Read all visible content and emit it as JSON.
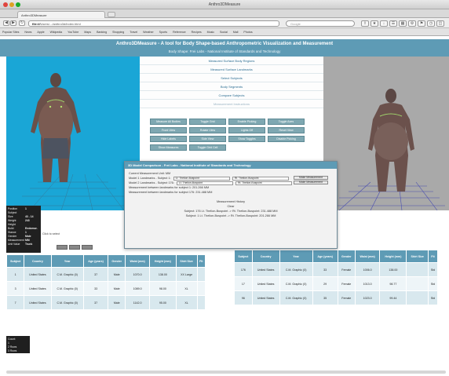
{
  "browser": {
    "window_title": "Anthro3DMeasure",
    "tab_title": "Anthro3DMeasure",
    "url_prefix": "file:///",
    "url_path": "Users/.../anthro3d/index.html",
    "search_placeholder": "Google",
    "bookmarks": [
      "Popular Sites",
      "News",
      "Apple",
      "Wikipedia",
      "YouTube",
      "Maps",
      "Banking",
      "Shopping",
      "Travel",
      "Weather",
      "Sports",
      "Reference",
      "Recipes",
      "Music",
      "Social",
      "Mail",
      "Photos"
    ]
  },
  "page": {
    "title": "Anthro3DMeasure - A tool for Body Shape-based Anthropometric Visualization and Measurement",
    "subtitle": "Body Shape: Frei Labs - National Institute of Standards and Technology",
    "menu": [
      "Measured Surface Body Regions",
      "Measured Surface Landmarks",
      "Select Subjects",
      "Body Segments",
      "Compare Subjects",
      "Measurement Instructions"
    ],
    "buttons": [
      "Measure All Bodies",
      "Toggle Grid",
      "Enable Picking",
      "Toggle Axes",
      "Front View",
      "Rotate View",
      "Lights Off",
      "Reset View",
      "Hide Labels",
      "Side View",
      "Show Toggles",
      "Disable Picking",
      "Show Measures",
      "Toggle Grid Cell"
    ]
  },
  "dialog": {
    "title": "3D Model Comparison - Frei Labs - National Institute of Standards and Technology",
    "line1": "Current Measurement Unit: MM",
    "line2_label": "Model 1 Landmarks - Subject 1:",
    "line2_select_a": "Lt. Thelion-Buspoint",
    "line2_select_b": "Rt. Thelion-Buspoint",
    "line3_label": "Model 2 Landmarks - Subject 176:",
    "line3_select_a": "Lt. Thelion-Buspoint",
    "line3_select_b": "Rt. Thelion-Buspoint",
    "make_measurement": "Make Measurement",
    "line4": "Measurement between landmarks for subject 1: 201.266 MM",
    "line5": "Measurement between landmarks for subject 176: 231.488 MM",
    "history_title": "Measurement History",
    "history_sub": "Clear",
    "history1": "Subject: 176 Lt. Thelion-Buspoint -> Rt. Thelion-Buspoint: 231.488 MM",
    "history2": "Subject: 1 Lt. Thelion-Buspoint -> Rt. Thelion-Buspoint: 201.266 MM"
  },
  "info_panel": {
    "rows": [
      [
        "Position",
        "1"
      ],
      [
        "Subject",
        ""
      ],
      [
        "Size",
        "43 - 14"
      ],
      [
        "Weight",
        "243"
      ],
      [
        "Height",
        ""
      ],
      [
        "Build",
        "Endomor."
      ],
      [
        "Stance",
        "1"
      ],
      [
        "Gender",
        "Male"
      ],
      [
        "Measurement",
        "MM"
      ],
      [
        "Unit Value",
        "Trunk"
      ]
    ]
  },
  "small_text": "Click to select",
  "table_left": {
    "headers": [
      "Subject",
      "Country",
      "Year",
      "Age (years)",
      "Gender",
      "Waist (mm)",
      "Height (mm)",
      "Shirt Size",
      "Fit"
    ],
    "rows": [
      [
        "1",
        "United States",
        "C.M. Graphic (0)",
        "37",
        "Male",
        "1070.0",
        "138.00",
        "XX Large",
        ""
      ],
      [
        "3",
        "United States",
        "C.M. Graphic (0)",
        "33",
        "Male",
        "1089.0",
        "98.00",
        "XL",
        ""
      ],
      [
        "7",
        "United States",
        "C.M. Graphic (0)",
        "37",
        "Male",
        "1142.0",
        "95.00",
        "XL",
        ""
      ]
    ]
  },
  "table_right": {
    "headers": [
      "Subject",
      "Country",
      "Year",
      "Age (years)",
      "Gender",
      "Waist (mm)",
      "Height (mm)",
      "Shirt Size",
      "Fit"
    ],
    "rows": [
      [
        "176",
        "United States",
        "C.M. Graphic (0)",
        "33",
        "Female",
        "1006.0",
        "138.00",
        "",
        "Std"
      ],
      [
        "17",
        "United States",
        "C.M. Graphic (0)",
        "29",
        "Female",
        "1013.0",
        "98.77",
        "",
        "Std"
      ],
      [
        "96",
        "United States",
        "C.M. Graphic (0)",
        "35",
        "Female",
        "1023.0",
        "99.44",
        "",
        "Std"
      ]
    ]
  },
  "mini_box": [
    "Count:",
    "1",
    "2  Rows",
    "3  Rows"
  ],
  "colors": {
    "header_blue": "#5e9bb5",
    "viewer_left_bg": "#1aa6d6",
    "viewer_right_bg": "#a9a9a9",
    "row_odd": "#d8e8ee",
    "row_even": "#eef5f8"
  }
}
